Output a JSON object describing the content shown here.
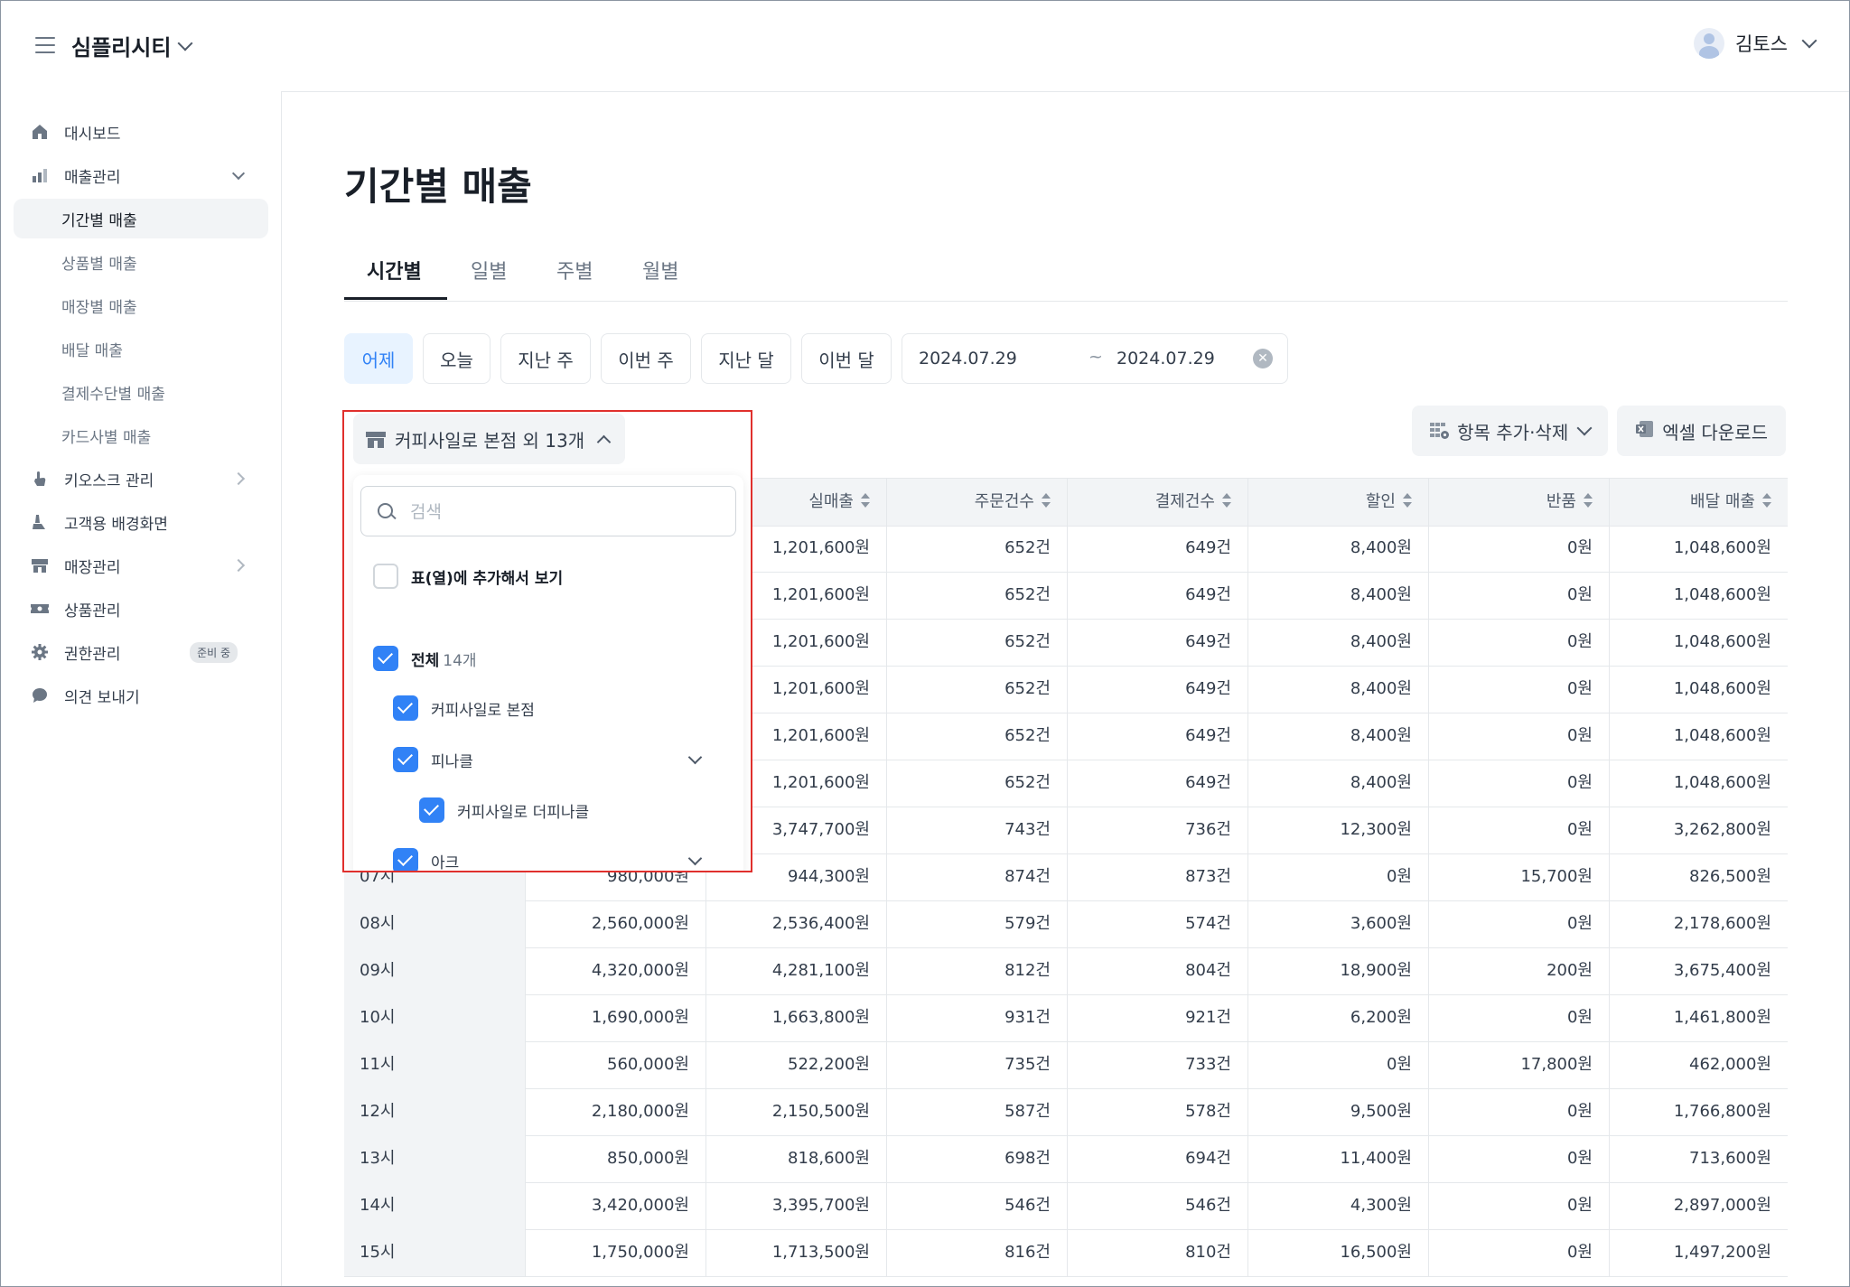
{
  "header": {
    "brand": "심플리시티",
    "user": "김토스"
  },
  "sidebar": {
    "items": [
      {
        "label": "대시보드"
      },
      {
        "label": "매출관리"
      },
      {
        "label": "기간별 매출"
      },
      {
        "label": "상품별 매출"
      },
      {
        "label": "매장별 매출"
      },
      {
        "label": "배달 매출"
      },
      {
        "label": "결제수단별 매출"
      },
      {
        "label": "카드사별 매출"
      },
      {
        "label": "키오스크 관리"
      },
      {
        "label": "고객용 배경화면"
      },
      {
        "label": "매장관리"
      },
      {
        "label": "상품관리"
      },
      {
        "label": "권한관리",
        "badge": "준비 중"
      },
      {
        "label": "의견 보내기"
      }
    ]
  },
  "page": {
    "title": "기간별 매출"
  },
  "tabs": [
    "시간별",
    "일별",
    "주별",
    "월별"
  ],
  "filters": {
    "presets": [
      "어제",
      "오늘",
      "지난 주",
      "이번 주",
      "지난 달",
      "이번 달"
    ],
    "start": "2024.07.29",
    "tilde": "~",
    "end": "2024.07.29"
  },
  "actions": {
    "columns": "항목 추가·삭제",
    "excel": "엑셀 다운로드"
  },
  "store_filter": {
    "label": "커피사일로 본점 외 13개",
    "search_placeholder": "검색",
    "add_to_table": "표(열)에 추가해서 보기",
    "all_label": "전체",
    "all_count": "14개",
    "stores": [
      "커피사일로 본점",
      "피나클",
      "커피사일로 더피나클",
      "아크"
    ]
  },
  "table": {
    "headers": [
      "실매출",
      "주문건수",
      "결제건수",
      "할인",
      "반품",
      "배달 매출"
    ],
    "hidden_rows": [
      [
        "1,201,600원",
        "652건",
        "649건",
        "8,400원",
        "0원",
        "1,048,600원"
      ],
      [
        "1,201,600원",
        "652건",
        "649건",
        "8,400원",
        "0원",
        "1,048,600원"
      ],
      [
        "1,201,600원",
        "652건",
        "649건",
        "8,400원",
        "0원",
        "1,048,600원"
      ],
      [
        "1,201,600원",
        "652건",
        "649건",
        "8,400원",
        "0원",
        "1,048,600원"
      ],
      [
        "1,201,600원",
        "652건",
        "649건",
        "8,400원",
        "0원",
        "1,048,600원"
      ],
      [
        "1,201,600원",
        "652건",
        "649건",
        "8,400원",
        "0원",
        "1,048,600원"
      ],
      [
        "3,747,700원",
        "743건",
        "736건",
        "12,300원",
        "0원",
        "3,262,800원"
      ]
    ],
    "rows": [
      [
        "07시",
        "980,000원",
        "944,300원",
        "874건",
        "873건",
        "0원",
        "15,700원",
        "826,500원"
      ],
      [
        "08시",
        "2,560,000원",
        "2,536,400원",
        "579건",
        "574건",
        "3,600원",
        "0원",
        "2,178,600원"
      ],
      [
        "09시",
        "4,320,000원",
        "4,281,100원",
        "812건",
        "804건",
        "18,900원",
        "200원",
        "3,675,400원"
      ],
      [
        "10시",
        "1,690,000원",
        "1,663,800원",
        "931건",
        "921건",
        "6,200원",
        "0원",
        "1,461,800원"
      ],
      [
        "11시",
        "560,000원",
        "522,200원",
        "735건",
        "733건",
        "0원",
        "17,800원",
        "462,000원"
      ],
      [
        "12시",
        "2,180,000원",
        "2,150,500원",
        "587건",
        "578건",
        "9,500원",
        "0원",
        "1,766,800원"
      ],
      [
        "13시",
        "850,000원",
        "818,600원",
        "698건",
        "694건",
        "11,400원",
        "0원",
        "713,600원"
      ],
      [
        "14시",
        "3,420,000원",
        "3,395,700원",
        "546건",
        "546건",
        "4,300원",
        "0원",
        "2,897,000원"
      ],
      [
        "15시",
        "1,750,000원",
        "1,713,500원",
        "816건",
        "810건",
        "16,500원",
        "0원",
        "1,497,200원"
      ]
    ]
  },
  "colors": {
    "accent": "#3182f6",
    "highlight": "#e0302d"
  }
}
